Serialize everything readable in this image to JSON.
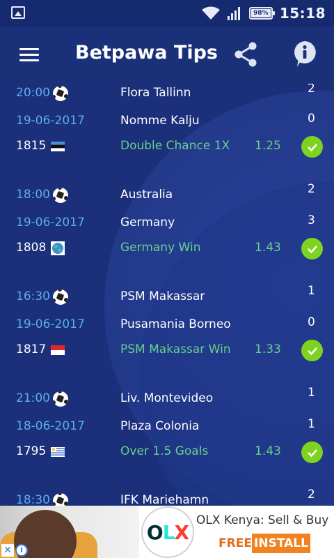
{
  "status_bar": {
    "time": "15:18",
    "battery_percent": "98%"
  },
  "app_bar": {
    "title": "Betpawa Tips"
  },
  "matches": [
    {
      "time": "20:00",
      "date": "19-06-2017",
      "id": "1815",
      "home": "Flora Tallinn",
      "away": "Nomme Kalju",
      "tip": "Double Chance 1X",
      "odds": "1.25",
      "home_score": "2",
      "away_score": "0",
      "flag": "estonia-flag"
    },
    {
      "time": "18:00",
      "date": "19-06-2017",
      "id": "1808",
      "home": "Australia",
      "away": "Germany",
      "tip": "Germany Win",
      "odds": "1.43",
      "home_score": "2",
      "away_score": "3",
      "flag": "world-icon"
    },
    {
      "time": "16:30",
      "date": "19-06-2017",
      "id": "1817",
      "home": "PSM Makassar",
      "away": "Pusamania Borneo",
      "tip": "PSM Makassar Win",
      "odds": "1.33",
      "home_score": "1",
      "away_score": "0",
      "flag": "indonesia-flag"
    },
    {
      "time": "21:00",
      "date": "18-06-2017",
      "id": "1795",
      "home": "Liv. Montevideo",
      "away": "Plaza Colonia",
      "tip": "Over 1.5 Goals",
      "odds": "1.43",
      "home_score": "1",
      "away_score": "1",
      "flag": "uruguay-flag"
    },
    {
      "time": "18:30",
      "home": "IFK Mariehamn",
      "home_score": "2"
    }
  ],
  "ad": {
    "title": "OLX Kenya: Sell & Buy ...",
    "free_label": "FREE",
    "install_label": "INSTALL",
    "logo_letters": [
      "O",
      "L",
      "X"
    ]
  }
}
